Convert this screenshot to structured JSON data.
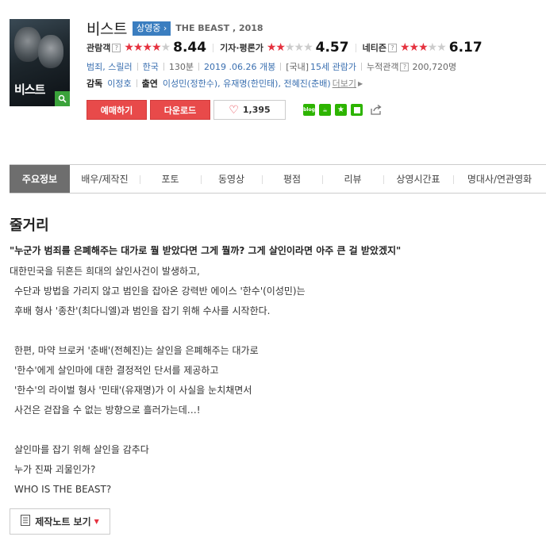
{
  "movie": {
    "title": "비스트",
    "status_badge": "상영중",
    "english_title": "THE BEAST , 2018",
    "poster_title": "비스트"
  },
  "ratings": [
    {
      "label": "관람객",
      "stars_on": 4,
      "stars_off": 1,
      "score": "8.44"
    },
    {
      "label": "기자·평론가",
      "stars_on": 2,
      "stars_off": 3,
      "score": "4.57"
    },
    {
      "label": "네티즌",
      "stars_on": 3,
      "stars_off": 2,
      "score": "6.17"
    }
  ],
  "info": {
    "genre": "범죄, 스릴러",
    "country": "한국",
    "runtime": "130분",
    "release": "2019 .06.26 개봉",
    "rating_prefix": "[국내]",
    "rating": "15세 관람가",
    "audience_label": "누적관객",
    "audience": "200,720명"
  },
  "credits": {
    "director_label": "감독",
    "director": "이정호",
    "cast_label": "출연",
    "cast": "이성민(정한수), 유재명(한민태), 전혜진(춘배)",
    "more": "더보기"
  },
  "buttons": {
    "reserve": "예매하기",
    "download": "다운로드",
    "like_count": "1,395"
  },
  "share": [
    {
      "icon": "blog-icon",
      "color": "#2db400",
      "text": "blog"
    },
    {
      "icon": "cafe-icon",
      "color": "#2db400",
      "text": "☕"
    },
    {
      "icon": "bookmark-star-icon",
      "color": "#2db400",
      "text": "★"
    },
    {
      "icon": "memo-icon",
      "color": "#2db400",
      "text": "■"
    },
    {
      "icon": "share-icon",
      "color": "#888888",
      "text": "↗"
    }
  ],
  "tabs": [
    {
      "label": "주요정보",
      "active": true
    },
    {
      "label": "배우/제작진",
      "active": false
    },
    {
      "label": "포토",
      "active": false
    },
    {
      "label": "동영상",
      "active": false
    },
    {
      "label": "평점",
      "active": false
    },
    {
      "label": "리뷰",
      "active": false
    },
    {
      "label": "상영시간표",
      "active": false
    },
    {
      "label": "명대사/연관영화",
      "active": false
    }
  ],
  "synopsis": {
    "section_title": "줄거리",
    "headline": "\"누군가 범죄를 은폐해주는 대가로 뭘 받았다면 그게 뭘까? 그게 살인이라면 아주 큰 걸 받았겠지\"",
    "lines": [
      "대한민국을 뒤흔든 희대의 살인사건이 발생하고,",
      "수단과 방법을 가리지 않고 범인을 잡아온 강력반 에이스 '한수'(이성민)는",
      "후배 형사 '종찬'(최다니엘)과 범인을 잡기 위해 수사를 시작한다.",
      "",
      "한편, 마약 브로커 '춘배'(전혜진)는 살인을 은폐해주는 대가로",
      "'한수'에게 살인마에 대한 결정적인 단서를 제공하고",
      "'한수'의 라이벌 형사 '민태'(유재명)가 이 사실을 눈치채면서",
      "사건은 걷잡을 수 없는 방향으로 흘러가는데…!",
      "",
      "살인마를 잡기 위해 살인을 감추다",
      "누가 진짜 괴물인가?",
      "WHO IS THE BEAST?"
    ]
  },
  "note_button": "제작노트 보기",
  "colors": {
    "accent_red": "#e84a4a",
    "link_blue": "#3a6fb0",
    "badge_blue": "#3b7ec0",
    "tab_active": "#6e6e6e"
  }
}
